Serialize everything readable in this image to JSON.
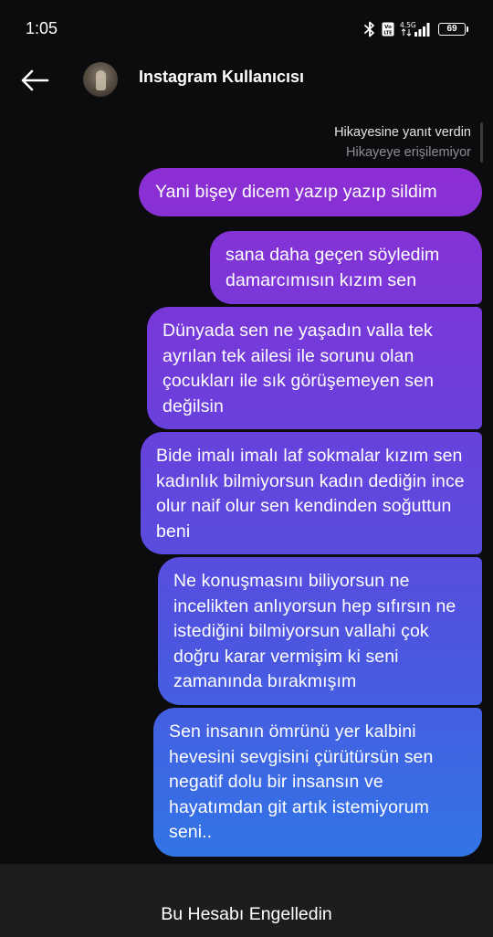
{
  "status_bar": {
    "time": "1:05",
    "battery_level": "69",
    "network_label": "4.5G",
    "volte_label": "Vo LTE"
  },
  "header": {
    "title": "Instagram Kullanıcısı"
  },
  "story_reply": {
    "title": "Hikayesine yanıt verdin",
    "subtitle": "Hikayeye erişilemiyor"
  },
  "messages": [
    {
      "text": "Yani bişey dicem yazıp yazıp sildim"
    },
    {
      "text": "sana daha geçen söyledim damarcımısın kızım sen"
    },
    {
      "text": "Dünyada sen ne yaşadın valla tek ayrılan tek ailesi ile sorunu olan çocukları ile sık görüşemeyen sen değilsin"
    },
    {
      "text": "Bide imalı imalı laf sokmalar kızım sen kadınlık bilmiyorsun kadın dediğin ince olur naif olur sen kendinden soğuttun beni"
    },
    {
      "text": "Ne konuşmasını biliyorsun ne incelikten anlıyorsun hep sıfırsın ne istediğini bilmiyorsun vallahi çok doğru karar vermişim ki seni zamanında bırakmışım"
    },
    {
      "text": "Sen insanın ömrünü yer kalbini hevesini sevgisini çürütürsün sen negatif dolu bir insansın ve hayatımdan git artık istemiyorum seni.."
    }
  ],
  "bubble_gradient": [
    "#9c2ccf",
    "#8b2fd4",
    "#6b3fdc",
    "#4d55e0",
    "#3175e6"
  ],
  "blocked_banner": {
    "text": "Bu Hesabı Engelledin"
  },
  "icons": {
    "back": "arrow-left-icon",
    "bluetooth": "bluetooth-icon",
    "signal": "signal-icon",
    "battery": "battery-icon"
  }
}
